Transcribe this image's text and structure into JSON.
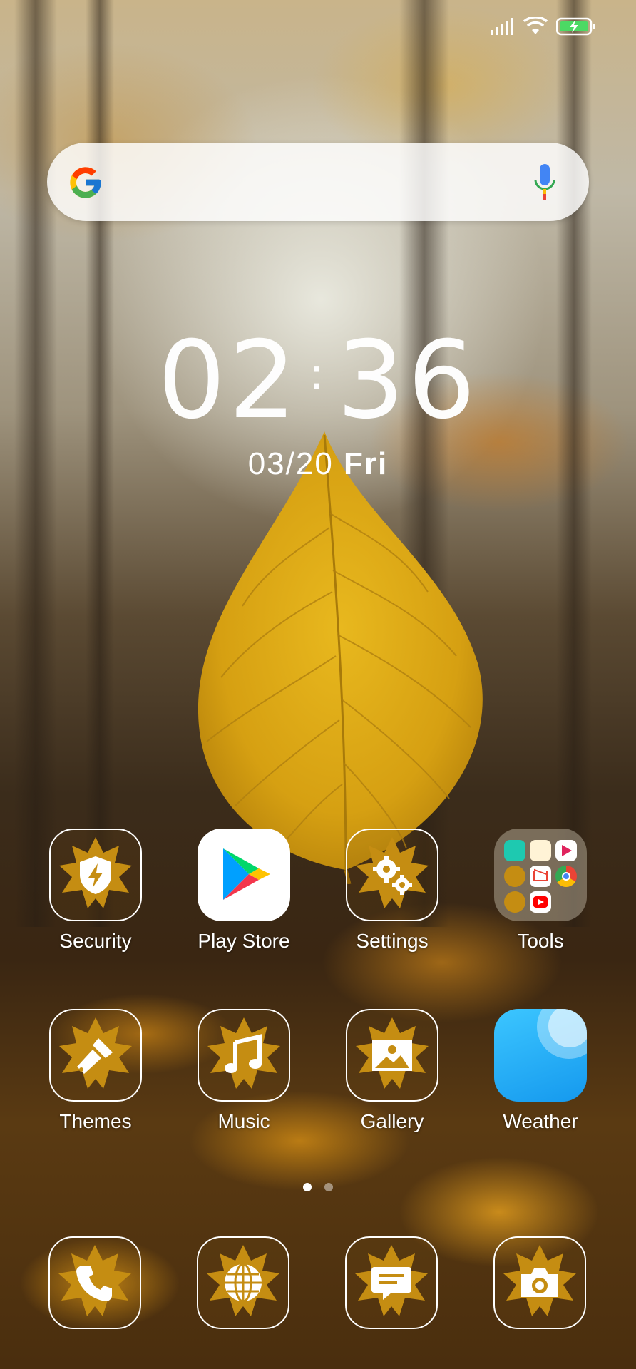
{
  "status_bar": {
    "icons": [
      "signal-icon",
      "wifi-icon",
      "battery-charging-icon"
    ],
    "battery_color": "#4cd964"
  },
  "search": {
    "logo": "google-g-icon",
    "mic": "microphone-icon"
  },
  "clock": {
    "hours": "02",
    "minutes": "36",
    "date": "03/20",
    "weekday": "Fri"
  },
  "apps": {
    "row1": [
      {
        "label": "Security",
        "icon": "shield-bolt-icon"
      },
      {
        "label": "Play Store",
        "icon": "play-store-icon"
      },
      {
        "label": "Settings",
        "icon": "gears-icon"
      },
      {
        "label": "Tools",
        "icon": "folder-icon"
      }
    ],
    "row2": [
      {
        "label": "Themes",
        "icon": "paintbrush-icon"
      },
      {
        "label": "Music",
        "icon": "music-note-icon"
      },
      {
        "label": "Gallery",
        "icon": "image-icon"
      },
      {
        "label": "Weather",
        "icon": "weather-icon"
      }
    ],
    "dock": [
      {
        "icon": "phone-icon"
      },
      {
        "icon": "globe-icon"
      },
      {
        "icon": "message-icon"
      },
      {
        "icon": "camera-icon"
      }
    ]
  },
  "pager": {
    "pages": 2,
    "current": 1
  },
  "theme_colors": {
    "leaf": "#d9a514",
    "leaf_icon": "#c58d12",
    "weather": "#2ab5f5"
  }
}
